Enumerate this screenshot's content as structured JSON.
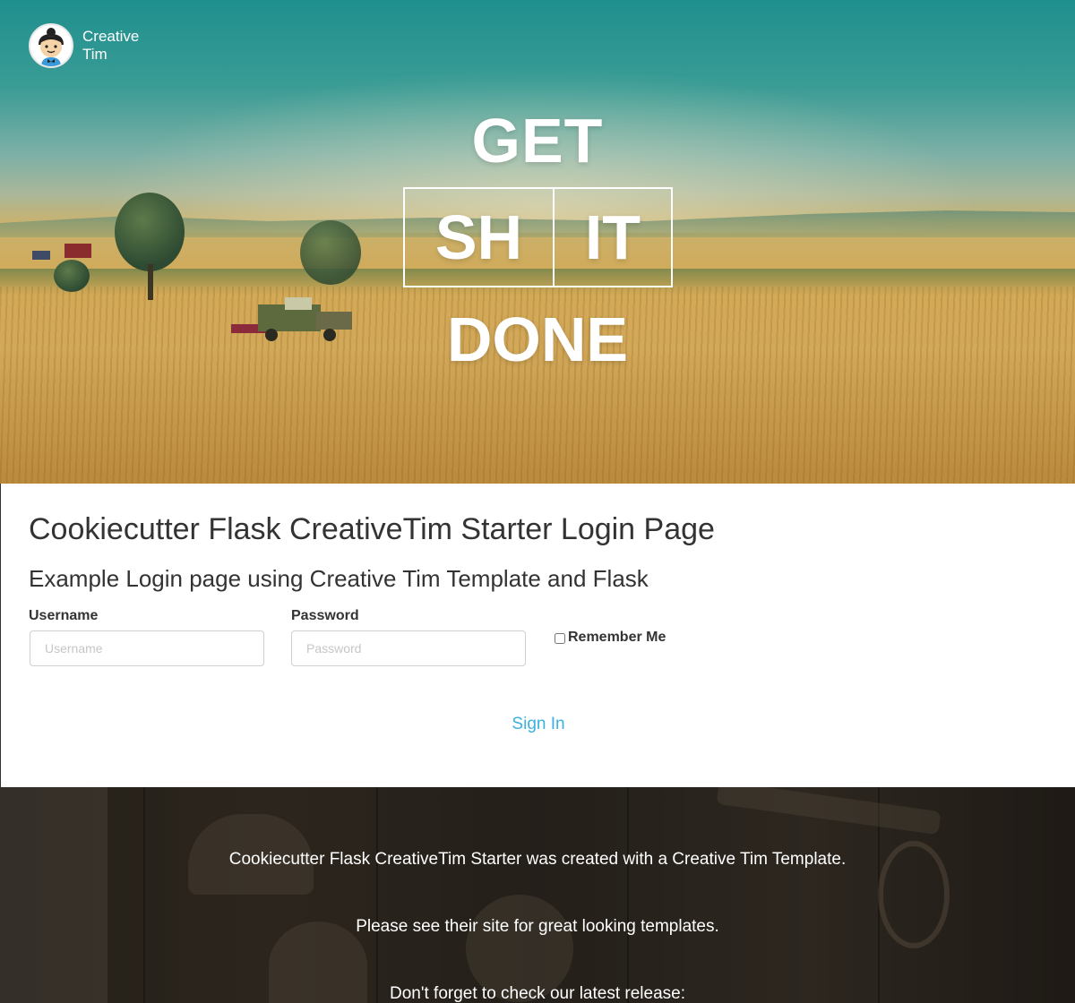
{
  "brand": {
    "name_line1": "Creative",
    "name_line2": "Tim"
  },
  "hero": {
    "line1": "GET",
    "boxed_left": "SH",
    "boxed_right": "IT",
    "line3": "DONE"
  },
  "login": {
    "title": "Cookiecutter Flask CreativeTim Starter Login Page",
    "subtitle": "Example Login page using Creative Tim Template and Flask",
    "username_label": "Username",
    "username_placeholder": "Username",
    "password_label": "Password",
    "password_placeholder": "Password",
    "remember_label": "Remember Me",
    "signin_label": "Sign In"
  },
  "footer": {
    "line1": "Cookiecutter Flask CreativeTim Starter was created with a Creative Tim Template.",
    "line2": "Please see their site for great looking templates.",
    "line3": "Don't forget to check our latest release:"
  },
  "colors": {
    "link": "#3bb1e0",
    "text": "#333333"
  }
}
